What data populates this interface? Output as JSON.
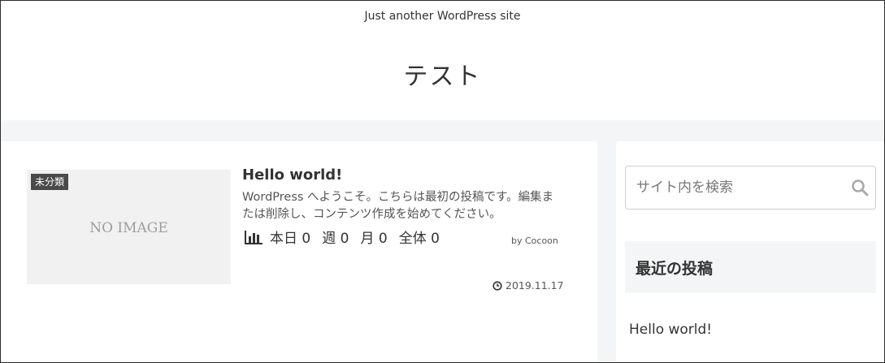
{
  "header": {
    "tagline": "Just another WordPress site",
    "site_title": "テスト"
  },
  "post": {
    "category": "未分類",
    "thumbnail_text": "NO IMAGE",
    "title": "Hello world!",
    "excerpt": "WordPress へようこそ。こちらは最初の投稿です。編集または削除し、コンテンツ作成を始めてください。",
    "stats": {
      "today": "本日 0",
      "week": "週 0",
      "month": "月 0",
      "total": "全体 0"
    },
    "author": "by Cocoon",
    "date": "2019.11.17"
  },
  "sidebar": {
    "search": {
      "placeholder": "サイト内を検索"
    },
    "recent_heading": "最近の投稿",
    "recent_posts": [
      "Hello world!"
    ]
  },
  "icons": {
    "stats": "bar-chart-icon",
    "date": "clock-icon",
    "search": "search-icon"
  },
  "colors": {
    "background": "#f4f5f7",
    "category_label": "#4a4a4a",
    "text": "#333333"
  }
}
